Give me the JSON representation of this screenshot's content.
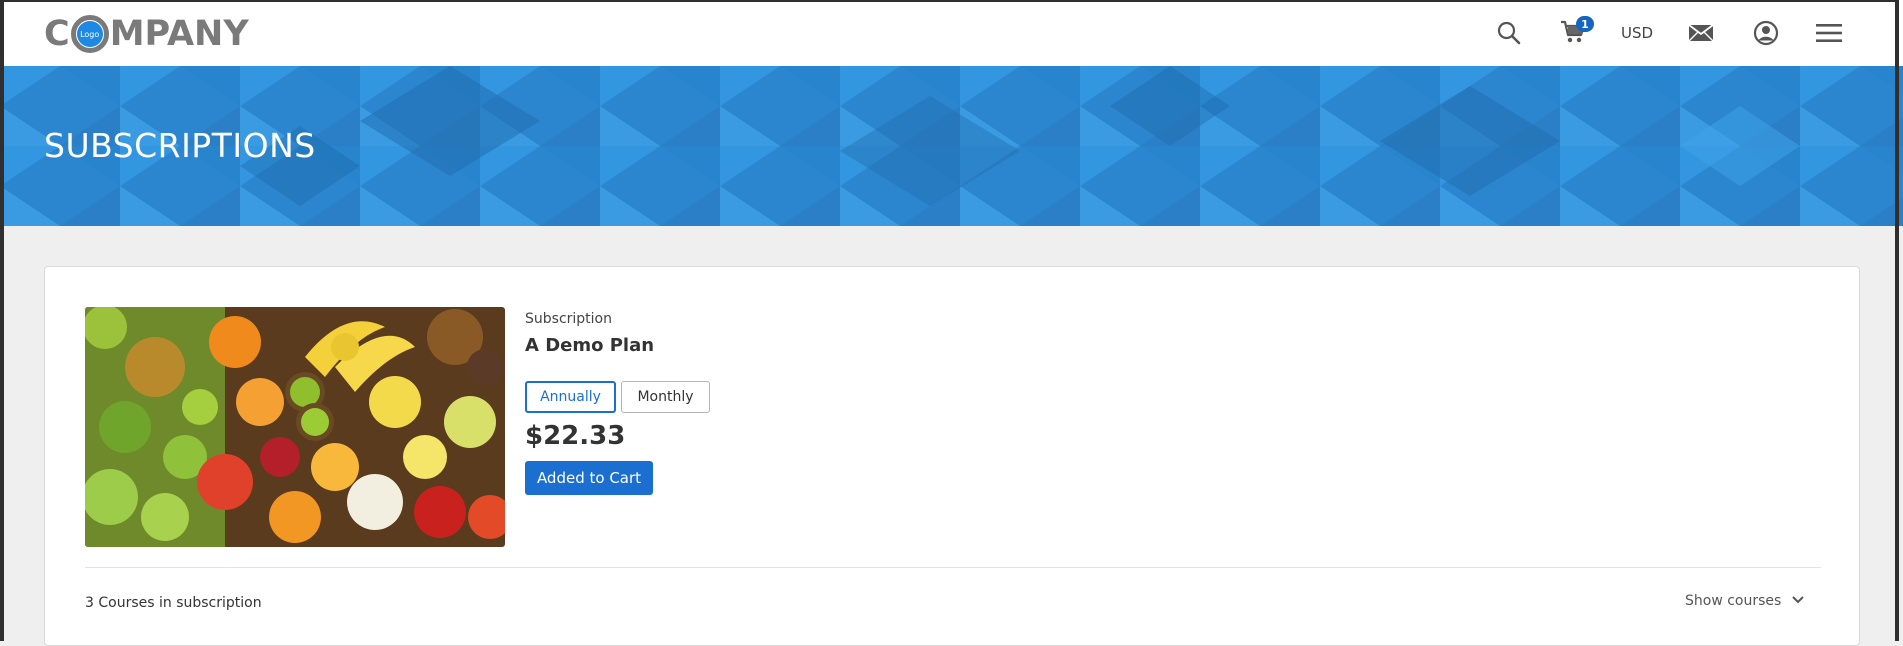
{
  "header": {
    "logo_prefix": "C",
    "logo_badge": "Logo",
    "logo_suffix": "MPANY",
    "cart_count": "1",
    "currency": "USD",
    "icons": [
      "search-icon",
      "cart-icon",
      "mail-icon",
      "account-icon",
      "menu-icon"
    ]
  },
  "banner": {
    "title": "SUBSCRIPTIONS",
    "color": "#2e8fd9"
  },
  "plan": {
    "type_label": "Subscription",
    "name": "A Demo Plan",
    "billing_options": [
      "Annually",
      "Monthly"
    ],
    "selected_billing": "Annually",
    "price": "$22.33",
    "cart_button_label": "Added to Cart",
    "courses_count_label": "3 Courses in subscription",
    "show_courses_label": "Show courses"
  },
  "colors": {
    "accent": "#1a6fd1",
    "badge": "#1565c0"
  }
}
